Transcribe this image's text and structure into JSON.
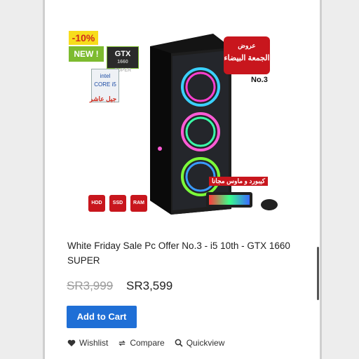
{
  "product": {
    "badges": {
      "discount": "-10%",
      "new": "NEW !",
      "gpu": "GTX",
      "gpu_model": "1660",
      "gpu_sub": "SUPER",
      "cpu": "CORE i5",
      "cpu_brand": "intel",
      "cpu_note": "جيل عاشر",
      "black_friday_top": "عروض",
      "black_friday_main": "الجمعة البيضاء",
      "offer_no": "No.3",
      "keyboard_note": "كيبورد و ماوس مجانا",
      "storage_hdd": "HDD",
      "storage_ssd": "SSD",
      "storage_ram": "RAM"
    },
    "title": "White Friday Sale Pc Offer No.3 - i5 10th - GTX 1660 SUPER",
    "old_price": "SR3,999",
    "new_price": "SR3,599",
    "add_to_cart": "Add to Cart",
    "actions": {
      "wishlist": "Wishlist",
      "compare": "Compare",
      "quickview": "Quickview"
    }
  },
  "colors": {
    "accent": "#1f6fd6",
    "sale_red": "#c8161d",
    "badge_yellow": "#f7dd1c",
    "badge_green": "#7dbb2f"
  }
}
